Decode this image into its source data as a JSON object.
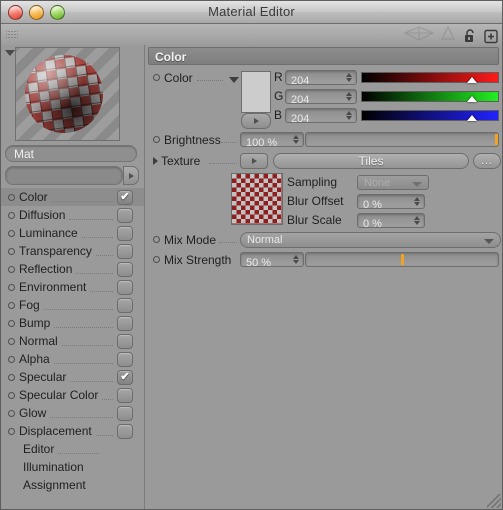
{
  "window": {
    "title": "Material Editor",
    "controls": [
      "close",
      "minimize",
      "zoom"
    ]
  },
  "toolbar": {
    "icons": [
      "drag-grip",
      "preview-shape-icon",
      "cone-icon",
      "lock-icon",
      "add-icon"
    ]
  },
  "sidebar": {
    "preview_name": "Mat",
    "link_value": "",
    "channels": [
      {
        "label": "Color",
        "checked": true,
        "selected": true
      },
      {
        "label": "Diffusion",
        "checked": false,
        "selected": false
      },
      {
        "label": "Luminance",
        "checked": false,
        "selected": false
      },
      {
        "label": "Transparency",
        "checked": false,
        "selected": false
      },
      {
        "label": "Reflection",
        "checked": false,
        "selected": false
      },
      {
        "label": "Environment",
        "checked": false,
        "selected": false
      },
      {
        "label": "Fog",
        "checked": false,
        "selected": false
      },
      {
        "label": "Bump",
        "checked": false,
        "selected": false
      },
      {
        "label": "Normal",
        "checked": false,
        "selected": false
      },
      {
        "label": "Alpha",
        "checked": false,
        "selected": false
      },
      {
        "label": "Specular",
        "checked": true,
        "selected": false
      },
      {
        "label": "Specular Color",
        "checked": false,
        "selected": false
      },
      {
        "label": "Glow",
        "checked": false,
        "selected": false
      },
      {
        "label": "Displacement",
        "checked": false,
        "selected": false
      }
    ],
    "pages": [
      "Editor",
      "Illumination",
      "Assignment"
    ]
  },
  "main": {
    "section_title": "Color",
    "color": {
      "label": "Color",
      "swatch_hex": "#cccccc",
      "components": [
        {
          "name": "R",
          "value": "204",
          "percent": 80
        },
        {
          "name": "G",
          "value": "204",
          "percent": 80
        },
        {
          "name": "B",
          "value": "204",
          "percent": 80
        }
      ]
    },
    "brightness": {
      "label": "Brightness",
      "value": "100 %",
      "percent": 100
    },
    "texture": {
      "label": "Texture",
      "button_label": "Tiles",
      "more_label": "...",
      "sampling": {
        "label": "Sampling",
        "value": "None",
        "disabled": true
      },
      "blur_offset": {
        "label": "Blur Offset",
        "value": "0 %"
      },
      "blur_scale": {
        "label": "Blur Scale",
        "value": "0 %"
      }
    },
    "mix_mode": {
      "label": "Mix Mode",
      "value": "Normal"
    },
    "mix_strength": {
      "label": "Mix Strength",
      "value": "50 %",
      "percent": 50
    }
  },
  "colors": {
    "accent_orange": "#f0a323",
    "panel_bg": "#9a9a9a",
    "header_bg": "#858585"
  }
}
